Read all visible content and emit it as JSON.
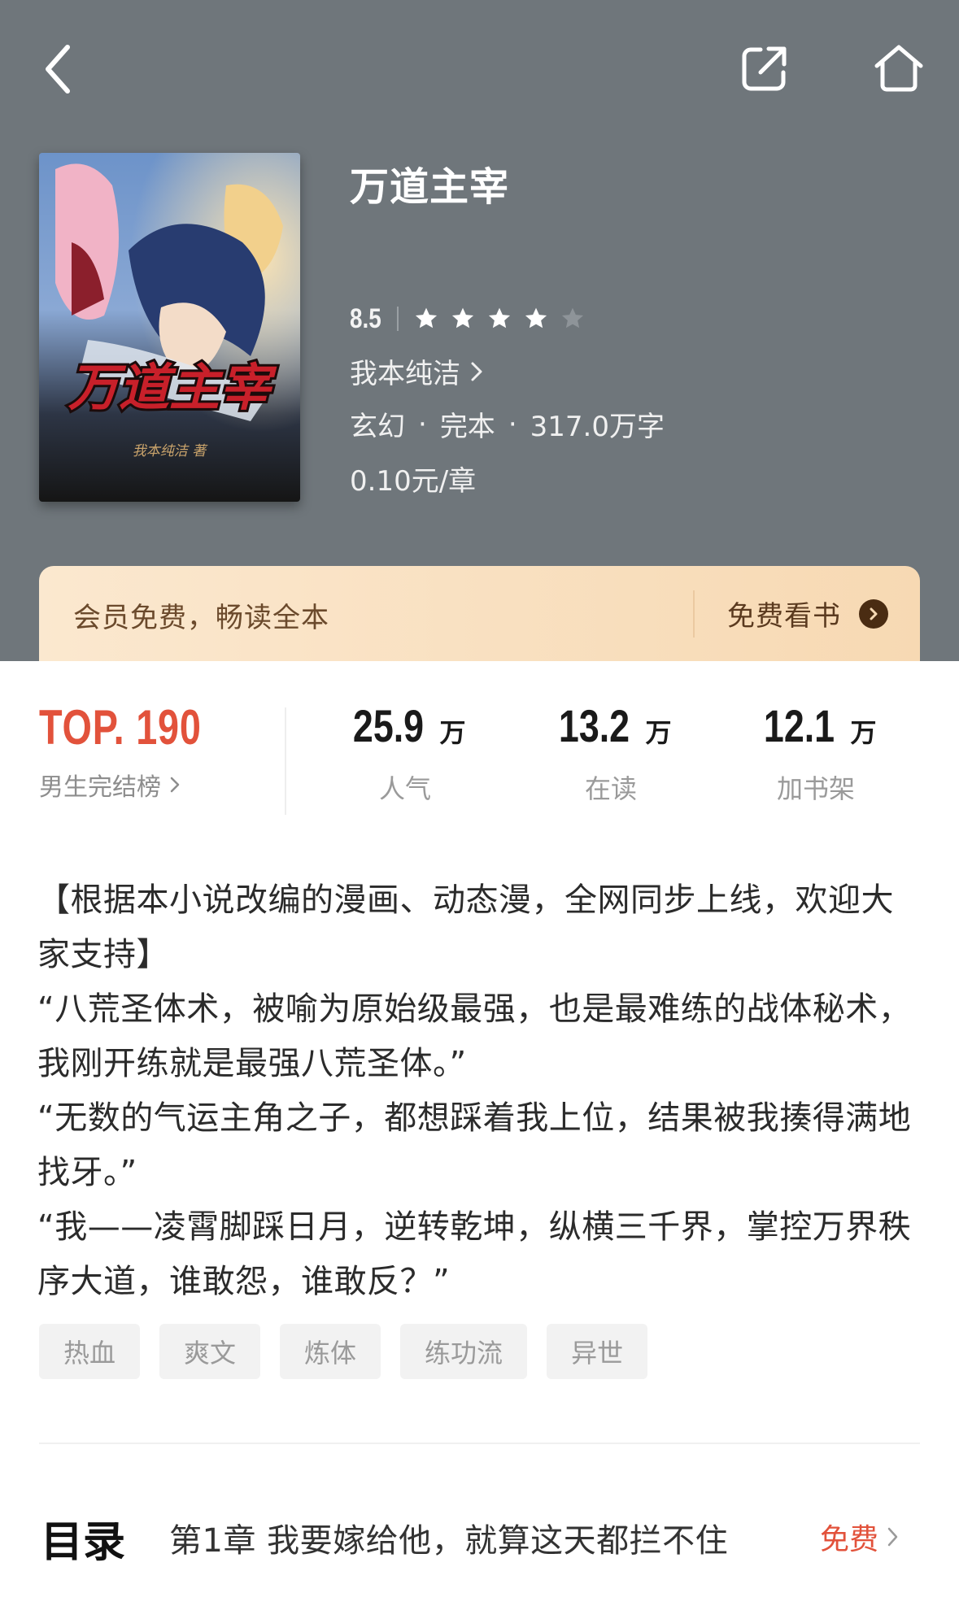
{
  "nav": {
    "back_icon": "chevron-left-icon",
    "share_icon": "share-icon",
    "home_icon": "home-icon"
  },
  "book": {
    "title": "万道主宰",
    "cover_title": "万道主宰",
    "cover_author": "我本纯洁 著",
    "rating": "8.5",
    "stars": 4,
    "stars_total": 5,
    "author": "我本纯洁",
    "genre": "玄幻",
    "dot": "·",
    "status": "完本",
    "word_count": "317.0万字",
    "price": "0.10元/章"
  },
  "vip": {
    "text": "会员免费，畅读全本",
    "action": "免费看书"
  },
  "stats": {
    "rank_value": "TOP. 190",
    "rank_label": "男生完结榜",
    "popularity_value": "25.9",
    "popularity_unit": "万",
    "popularity_label": "人气",
    "reading_value": "13.2",
    "reading_unit": "万",
    "reading_label": "在读",
    "shelf_value": "12.1",
    "shelf_unit": "万",
    "shelf_label": "加书架"
  },
  "description": [
    "【根据本小说改编的漫画、动态漫，全网同步上线，欢迎大家支持】",
    "“八荒圣体术，被喻为原始级最强，也是最难练的战体秘术，我刚开练就是最强八荒圣体。”",
    "“无数的气运主角之子，都想踩着我上位，结果被我揍得满地找牙。”",
    "“我——凌霄脚踩日月，逆转乾坤，纵横三千界，掌控万界秩序大道，谁敢怨，谁敢反？”"
  ],
  "tags": [
    "热血",
    "爽文",
    "炼体",
    "练功流",
    "异世"
  ],
  "toc": {
    "title": "目录",
    "latest_chapter": "第1章  我要嫁给他，就算这天都拦不住",
    "free_label": "免费"
  },
  "colors": {
    "header_bg": "#6f767b",
    "accent_red": "#e2523b",
    "vip_gold": "#f7d9b3"
  }
}
